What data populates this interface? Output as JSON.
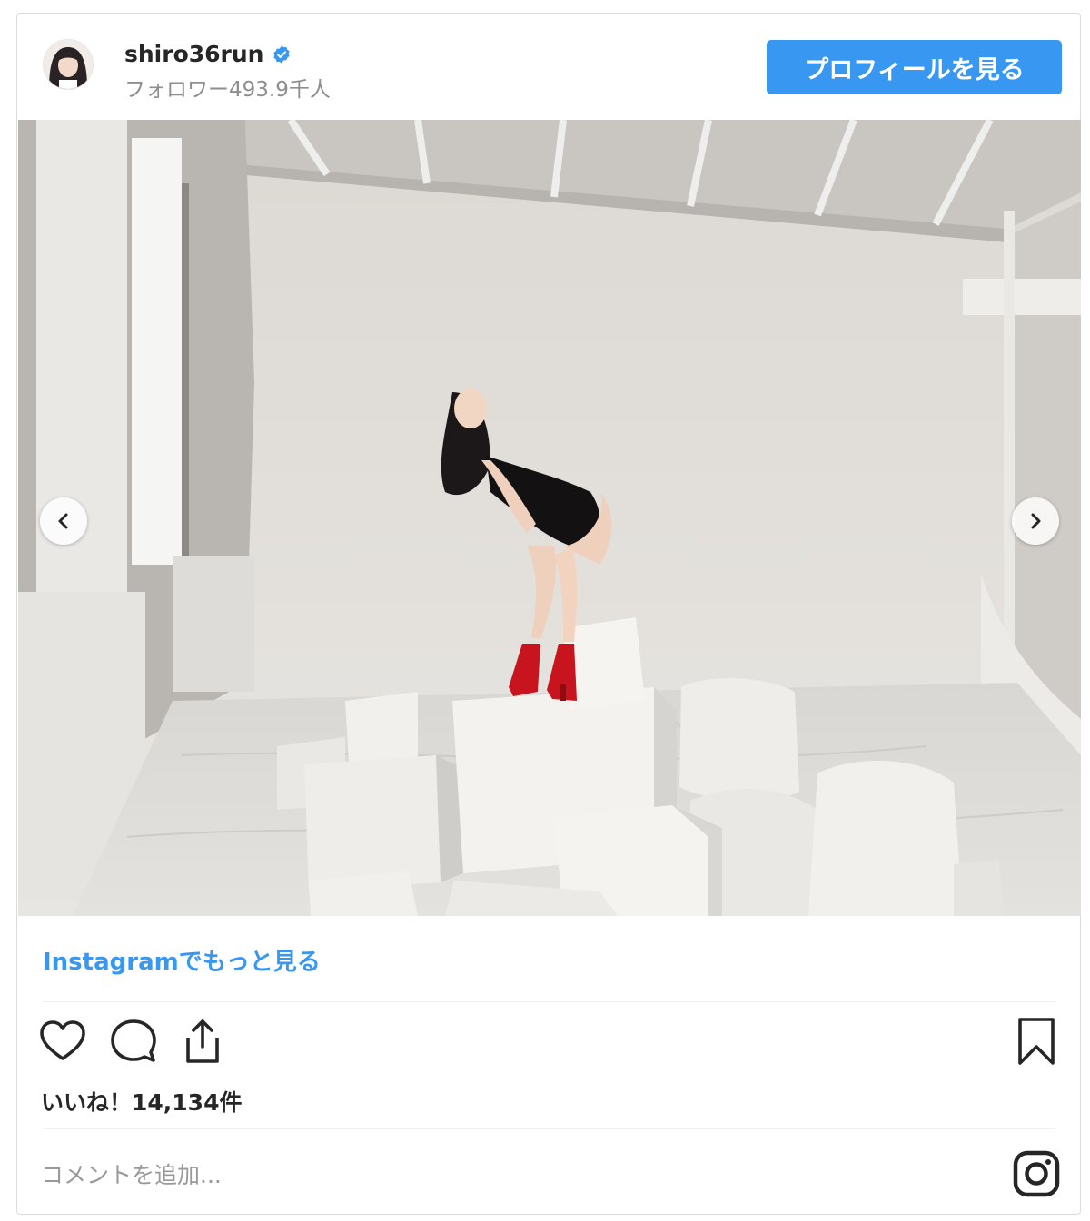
{
  "post": {
    "username": "shiro36run",
    "followers": "フォロワー493.9千人",
    "profile_button": "プロフィールを見る",
    "more_link": "Instagramでもっと見る",
    "likes": "いいね！14,134件",
    "comment_placeholder": "コメントを追加..."
  },
  "icons": {
    "verified": "verified-badge-icon",
    "prev": "chevron-left-icon",
    "next": "chevron-right-icon",
    "like": "heart-icon",
    "comment": "comment-bubble-icon",
    "share": "share-icon",
    "save": "bookmark-icon",
    "brand": "instagram-logo-icon"
  },
  "colors": {
    "accent": "#3897f0",
    "text": "#262626",
    "muted": "#8e8e8e",
    "boots": "#c8141e"
  }
}
